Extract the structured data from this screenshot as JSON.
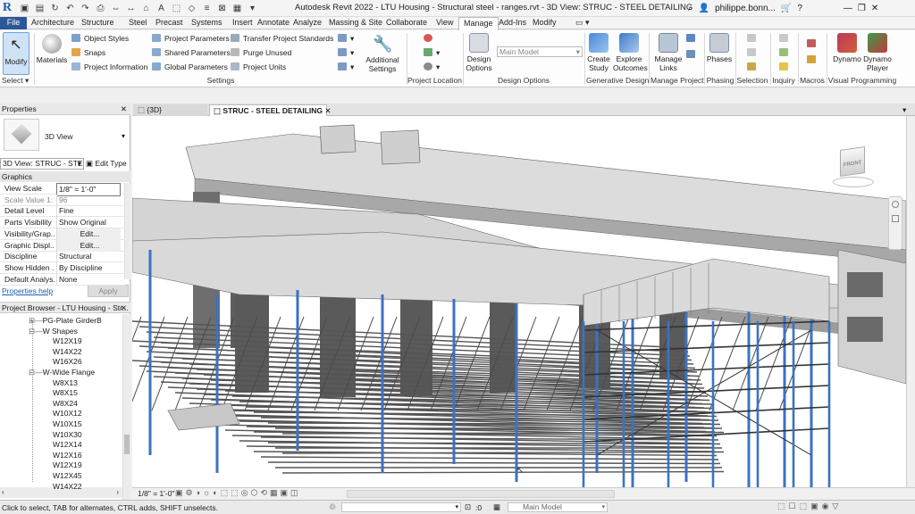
{
  "app": {
    "logo": "R",
    "window_title": "Autodesk Revit 2022 - LTU Housing - Structural steel - ranges.rvt - 3D View: STRUC - STEEL DETAILING",
    "user": "philippe.bonn...",
    "search_icon": "binoculars-icon",
    "window_controls": [
      "minimize",
      "restore",
      "close"
    ]
  },
  "tabs": [
    "File",
    "Architecture",
    "Structure",
    "Steel",
    "Precast",
    "Systems",
    "Insert",
    "Annotate",
    "Analyze",
    "Massing & Site",
    "Collaborate",
    "View",
    "Manage",
    "Add-Ins",
    "Modify"
  ],
  "active_tab": "Manage",
  "ribbon": {
    "select": {
      "modify": "Modify",
      "panel": "Select"
    },
    "settings": {
      "materials": "Materials",
      "object_styles": "Object  Styles",
      "snaps": "Snaps",
      "project_information": "Project  Information",
      "project_parameters": "Project  Parameters",
      "shared_parameters": "Shared  Parameters",
      "global_parameters": "Global  Parameters",
      "transfer_standards": "Transfer  Project Standards",
      "purge_unused": "Purge  Unused",
      "project_units": "Project  Units",
      "additional_settings_1": "Additional",
      "additional_settings_2": "Settings",
      "panel": "Settings"
    },
    "project_location": {
      "panel": "Project Location"
    },
    "design_options": {
      "btn1": "Design",
      "btn2": "Options",
      "selected": "Main Model",
      "panel": "Design Options"
    },
    "generative": {
      "create1": "Create",
      "create2": "Study",
      "explore1": "Explore",
      "explore2": "Outcomes",
      "panel": "Generative Design"
    },
    "manage_project": {
      "links1": "Manage",
      "links2": "Links",
      "panel": "Manage Project"
    },
    "phasing": {
      "phases": "Phases",
      "panel": "Phasing"
    },
    "selection": {
      "panel": "Selection"
    },
    "inquiry": {
      "panel": "Inquiry"
    },
    "macros": {
      "panel": "Macros"
    },
    "visual_programming": {
      "dynamo": "Dynamo",
      "player1": "Dynamo",
      "player2": "Player",
      "panel": "Visual Programming"
    }
  },
  "properties": {
    "title": "Properties",
    "type_name": "3D View",
    "selector": "3D View: STRUC - STEE",
    "edit_type": "Edit Type",
    "section": "Graphics",
    "rows": [
      {
        "k": "View Scale",
        "v": "1/8\" = 1'-0\""
      },
      {
        "k": "Scale Value   1:",
        "v": "96"
      },
      {
        "k": "Detail Level",
        "v": "Fine"
      },
      {
        "k": "Parts Visibility",
        "v": "Show Original"
      },
      {
        "k": "Visibility/Grap...",
        "v": "Edit..."
      },
      {
        "k": "Graphic Displ...",
        "v": "Edit..."
      },
      {
        "k": "Discipline",
        "v": "Structural"
      },
      {
        "k": "Show Hidden ...",
        "v": "By Discipline"
      },
      {
        "k": "Default Analys...",
        "v": "None"
      }
    ],
    "help": "Properties help",
    "apply": "Apply"
  },
  "browser": {
    "title": "Project Browser - LTU Housing - Str...",
    "items": [
      {
        "t": "PG-Plate GirderB",
        "lvl": 1,
        "sym": "⊞"
      },
      {
        "t": "W Shapes",
        "lvl": 1,
        "sym": "⊟"
      },
      {
        "t": "W12X19",
        "lvl": 2
      },
      {
        "t": "W14X22",
        "lvl": 2
      },
      {
        "t": "W16X26",
        "lvl": 2
      },
      {
        "t": "W-Wide Flange",
        "lvl": 1,
        "sym": "⊟"
      },
      {
        "t": "W8X13",
        "lvl": 2
      },
      {
        "t": "W8X15",
        "lvl": 2
      },
      {
        "t": "W8X24",
        "lvl": 2
      },
      {
        "t": "W10X12",
        "lvl": 2
      },
      {
        "t": "W10X15",
        "lvl": 2
      },
      {
        "t": "W10X30",
        "lvl": 2
      },
      {
        "t": "W12X14",
        "lvl": 2
      },
      {
        "t": "W12X16",
        "lvl": 2
      },
      {
        "t": "W12X19",
        "lvl": 2
      },
      {
        "t": "W12X45",
        "lvl": 2
      },
      {
        "t": "W14X22",
        "lvl": 2
      }
    ]
  },
  "views": {
    "tab1": "{3D}",
    "tab2": "STRUC - STEEL DETAILING",
    "viewcube_face": "FRONT"
  },
  "view_control": {
    "scale": "1/8\" = 1'-0\""
  },
  "status": {
    "message": "Click to select, TAB for alternates, CTRL adds, SHIFT unselects.",
    "zero": ":0",
    "model": "Main Model"
  },
  "colors": {
    "file_tab": "#2b5797",
    "column_blue": "#3b72c4",
    "slab_gray": "#cfcfcf"
  }
}
